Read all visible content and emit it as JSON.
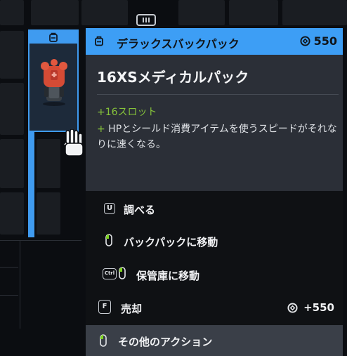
{
  "background": {
    "tab_icon": "inventory-tab-icon"
  },
  "slot": {
    "badge_icon": "backpack-badge-icon",
    "item_icon": "medical-backpack-icon",
    "accent_color": "#3f9bf0"
  },
  "panel": {
    "header": {
      "icon": "backpack-icon",
      "title": "デラックスバックパック",
      "price_icon": "currency-icon",
      "price": "550",
      "color": "#3d9ef5"
    },
    "item_name": "16XSメディカルパック",
    "stat": "+16スロット",
    "description_plus": "+",
    "description": " HPとシールド消費アイテムを使うスピードがそれなりに速くなる。",
    "stat_color": "#86c33a"
  },
  "actions": [
    {
      "key": "U",
      "key_icon": "key-u-icon",
      "label": "調べる"
    },
    {
      "key_icon": "left-mouse-icon",
      "label": "バックパックに移動"
    },
    {
      "key": "Ctrl",
      "key_icon": "ctrl-left-mouse-icon",
      "label": "保管庫に移動"
    },
    {
      "key": "F",
      "key_icon": "key-f-icon",
      "label": "売却",
      "value_icon": "currency-icon",
      "value": "+550"
    },
    {
      "key_icon": "right-mouse-icon",
      "label": "その他のアクション"
    }
  ],
  "cursor_icon": "hand-cursor-icon"
}
